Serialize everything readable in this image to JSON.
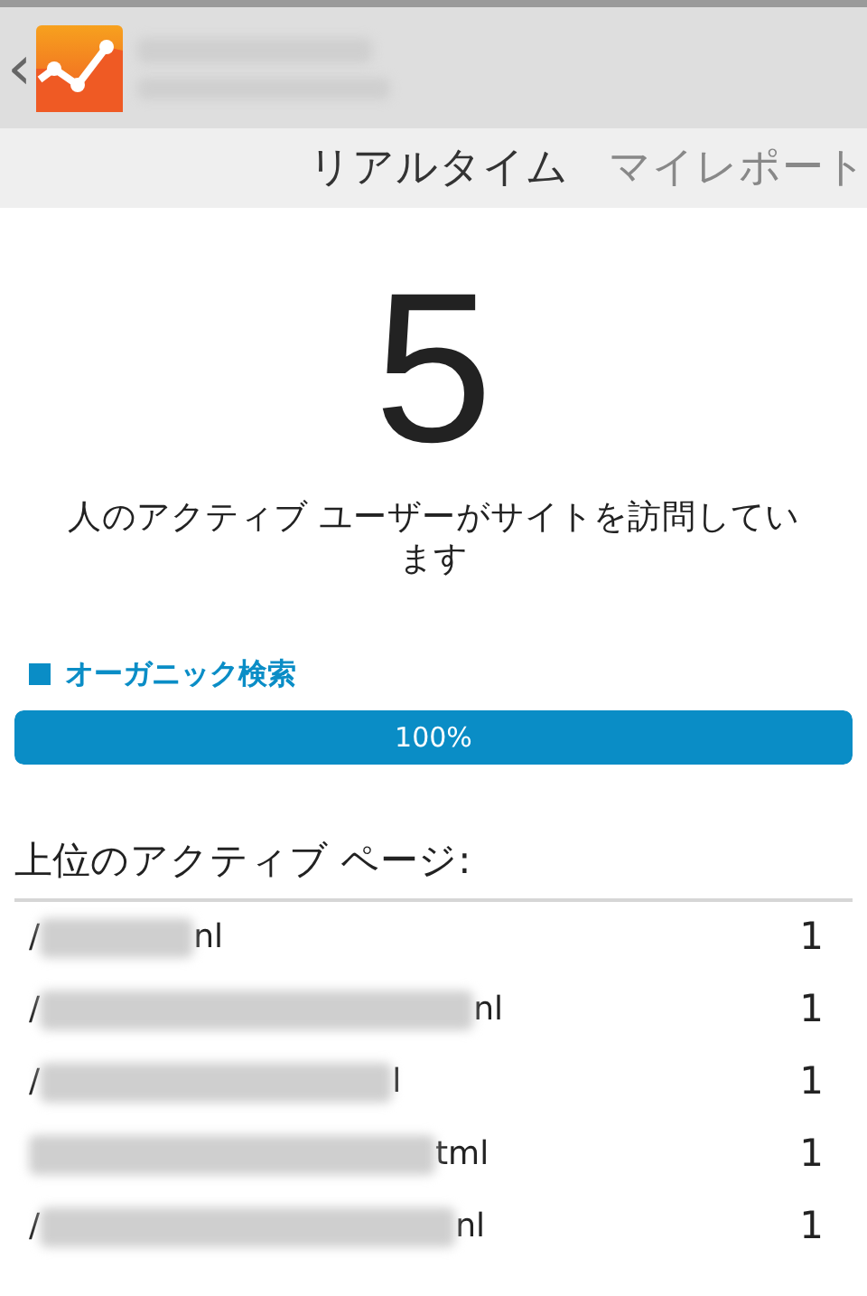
{
  "header": {
    "back": "‹"
  },
  "tabs": [
    {
      "label": "リアルタイム",
      "selected": true
    },
    {
      "label": "マイレポート",
      "selected": false
    }
  ],
  "active_users": {
    "count": "5",
    "caption": "人のアクティブ ユーザーがサイトを訪問しています"
  },
  "traffic": {
    "label": "オーガニック検索",
    "color": "#0a8dc6",
    "level": 1,
    "reading": "100%"
  },
  "top_pages": {
    "title": "上位のアクティブ ページ:",
    "rows": [
      {
        "path_start": "/",
        "path_end": "nl",
        "count": "1"
      },
      {
        "path_start": "/",
        "path_end": "nl",
        "count": "1"
      },
      {
        "path_start": "/",
        "path_end": "l",
        "count": "1"
      },
      {
        "path_start": "",
        "path_end": "tml",
        "count": "1"
      },
      {
        "path_start": "/",
        "path_end": "nl",
        "count": "1"
      }
    ]
  }
}
